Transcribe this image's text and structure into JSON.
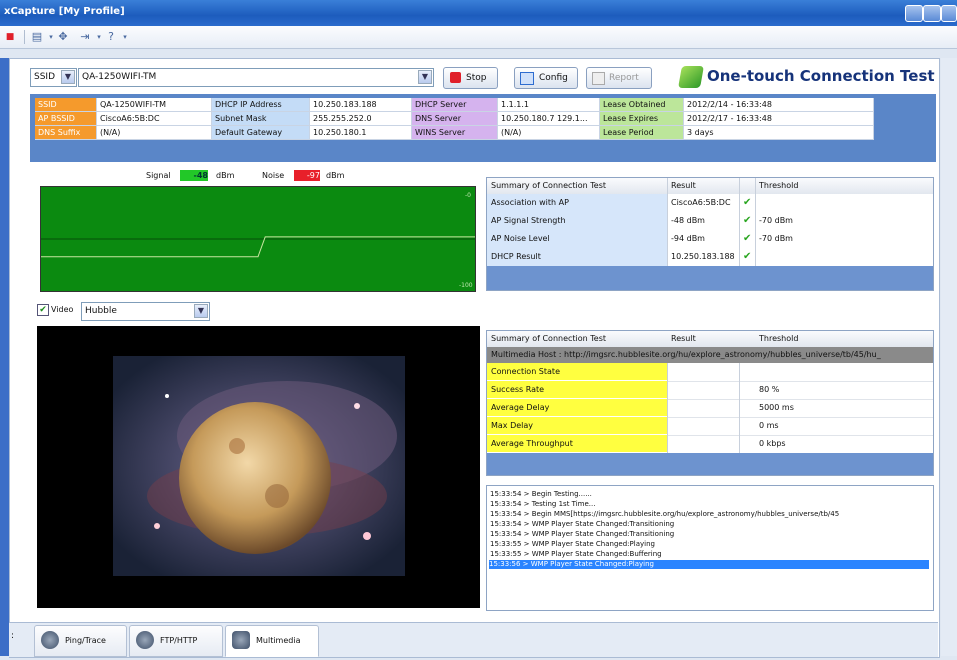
{
  "window": {
    "title": "xCapture [My Profile]"
  },
  "toolbar": {
    "items": [
      "stop-icon",
      "view-icon",
      "move-icon",
      "export-icon",
      "help-icon"
    ]
  },
  "ssid_bar": {
    "ssid_label": "SSID",
    "ssid_value": "QA-1250WIFI-TM",
    "stop_label": "Stop",
    "config_label": "Config",
    "report_label": "Report",
    "heading": "One-touch Connection Test"
  },
  "info": {
    "ssid_label": "SSID",
    "ssid_value": "QA-1250WIFI-TM",
    "apbssid_label": "AP BSSID",
    "apbssid_value": "CiscoA6:5B:DC",
    "dnssuffix_label": "DNS Suffix",
    "dnssuffix_value": "(N/A)",
    "dhcpip_label": "DHCP IP Address",
    "dhcpip_value": "10.250.183.188",
    "subnet_label": "Subnet Mask",
    "subnet_value": "255.255.252.0",
    "gateway_label": "Default Gateway",
    "gateway_value": "10.250.180.1",
    "dhcpserver_label": "DHCP Server",
    "dhcpserver_value": "1.1.1.1",
    "dnsserver_label": "DNS Server",
    "dnsserver_value": "10.250.180.7 129.1...",
    "wins_label": "WINS Server",
    "wins_value": "(N/A)",
    "obtained_label": "Lease Obtained",
    "obtained_value": "2012/2/14 - 16:33:48",
    "expires_label": "Lease Expires",
    "expires_value": "2012/2/17 - 16:33:48",
    "period_label": "Lease Period",
    "period_value": "3 days"
  },
  "chart_legend": {
    "signal_label": "Signal",
    "signal_value": "-48",
    "signal_unit": "dBm",
    "noise_label": "Noise",
    "noise_value": "-97",
    "noise_unit": "dBm",
    "top_tick": "-0",
    "bottom_tick": "-100"
  },
  "chart_data": {
    "type": "line",
    "series": [
      {
        "name": "Signal",
        "values": [
          -67,
          -67,
          -67,
          -67,
          -67,
          -67,
          -67,
          -67,
          -67,
          -67,
          -67,
          -67,
          -67,
          -67,
          -67,
          -67,
          -67,
          -67,
          -67,
          -67,
          -67,
          -67,
          -67,
          -67,
          -67,
          -67,
          -67,
          -67,
          -67,
          -67,
          -67,
          -48,
          -48,
          -48,
          -48,
          -48,
          -48,
          -48,
          -48,
          -48,
          -48,
          -48,
          -48,
          -48,
          -48,
          -48,
          -48,
          -48,
          -48,
          -48,
          -48,
          -48,
          -48,
          -48,
          -48,
          -48,
          -48,
          -48,
          -48,
          -48,
          -48
        ],
        "color": "#c8e6a0"
      }
    ],
    "ylim": [
      -100,
      0
    ]
  },
  "summary1": {
    "headers": [
      "Summary of Connection Test",
      "Result",
      "",
      "Threshold"
    ],
    "rows": [
      {
        "name": "Association with AP",
        "result": "CiscoA6:5B:DC",
        "ok": "✔",
        "threshold": ""
      },
      {
        "name": "AP Signal Strength",
        "result": "-48 dBm",
        "ok": "✔",
        "threshold": "-70 dBm"
      },
      {
        "name": "AP Noise Level",
        "result": "-94 dBm",
        "ok": "✔",
        "threshold": "-70 dBm"
      },
      {
        "name": "DHCP Result",
        "result": "10.250.183.188",
        "ok": "✔",
        "threshold": ""
      }
    ]
  },
  "video": {
    "checkbox_label": "Video",
    "select_value": "Hubble"
  },
  "summary2": {
    "headers": [
      "Summary of Connection Test",
      "Result",
      "",
      "Threshold"
    ],
    "host_row": "Multimedia Host : http://imgsrc.hubblesite.org/hu/explore_astronomy/hubbles_universe/tb/45/hu_",
    "rows": [
      {
        "name": "Connection State",
        "result": "",
        "threshold": ""
      },
      {
        "name": "Success Rate",
        "result": "",
        "threshold": "80 %"
      },
      {
        "name": "Average Delay",
        "result": "",
        "threshold": "5000 ms"
      },
      {
        "name": "Max Delay",
        "result": "",
        "threshold": "0 ms"
      },
      {
        "name": "Average Throughput",
        "result": "",
        "threshold": "0 kbps"
      }
    ]
  },
  "log": [
    "15:33:54 > Begin Testing......",
    "15:33:54 > Testing 1st Time...",
    "15:33:54 > Begin MMS[https://imgsrc.hubblesite.org/hu/explore_astronomy/hubbles_universe/tb/45",
    "15:33:54 > WMP Player State Changed:Transitioning",
    "15:33:54 > WMP Player State Changed:Transitioning",
    "15:33:55 > WMP Player State Changed:Playing",
    "15:33:55 > WMP Player State Changed:Buffering",
    "15:33:56 > WMP Player State Changed:Playing"
  ],
  "tabs": [
    "Ping/Trace",
    "FTP/HTTP",
    "Multimedia"
  ]
}
